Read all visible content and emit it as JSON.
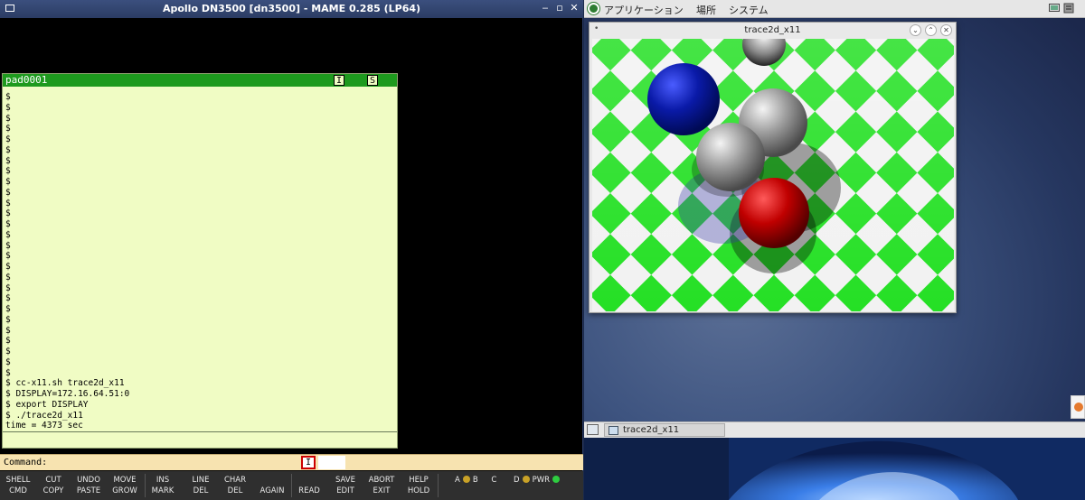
{
  "mame": {
    "title": "Apollo DN3500 [dn3500] - MAME 0.285 (LP64)",
    "window_controls": [
      "‒",
      "▫",
      "✕"
    ]
  },
  "pad": {
    "title": "pad0001",
    "flag_i": "I",
    "flag_s": "S",
    "lines": [
      "$",
      "$",
      "$",
      "$",
      "$",
      "$",
      "$",
      "$",
      "$",
      "$",
      "$",
      "$",
      "$",
      "$",
      "$",
      "$",
      "$",
      "$",
      "$",
      "$",
      "$",
      "$",
      "$",
      "$",
      "$",
      "$",
      "$",
      "$ cc-x11.sh trace2d_x11",
      "$ DISPLAY=172.16.64.51:0",
      "$ export DISPLAY",
      "$ ./trace2d_x11",
      "time = 4373 sec"
    ]
  },
  "command": {
    "label": "Command:",
    "insert_flag": "I"
  },
  "keys": [
    {
      "top": "SHELL",
      "bottom": "CMD"
    },
    {
      "top": "CUT",
      "bottom": "COPY"
    },
    {
      "top": "UNDO",
      "bottom": "PASTE"
    },
    {
      "top": "MOVE",
      "bottom": "GROW"
    },
    {
      "top": "INS",
      "bottom": "MARK"
    },
    {
      "top": "LINE",
      "bottom": "DEL"
    },
    {
      "top": "CHAR",
      "bottom": "DEL"
    },
    {
      "top": "",
      "bottom": "AGAIN"
    },
    {
      "top": "",
      "bottom": "READ"
    },
    {
      "top": "SAVE",
      "bottom": "EDIT"
    },
    {
      "top": "ABORT",
      "bottom": "EXIT"
    },
    {
      "top": "HELP",
      "bottom": "HOLD"
    }
  ],
  "leds": {
    "a": "A",
    "b": "B",
    "c": "C",
    "d": "D",
    "pwr": "PWR",
    "led_color_amber": "#c9a227",
    "led_color_green": "#2ecc40"
  },
  "desktop": {
    "menus": [
      "アプリケーション",
      "場所",
      "システム"
    ],
    "trace_window_title": "trace2d_x11",
    "taskbar_item": "trace2d_x11"
  },
  "colors": {
    "pad_bg": "#f0fcc4",
    "pad_title": "#1e9a1e",
    "checker_green": "#25e025"
  }
}
